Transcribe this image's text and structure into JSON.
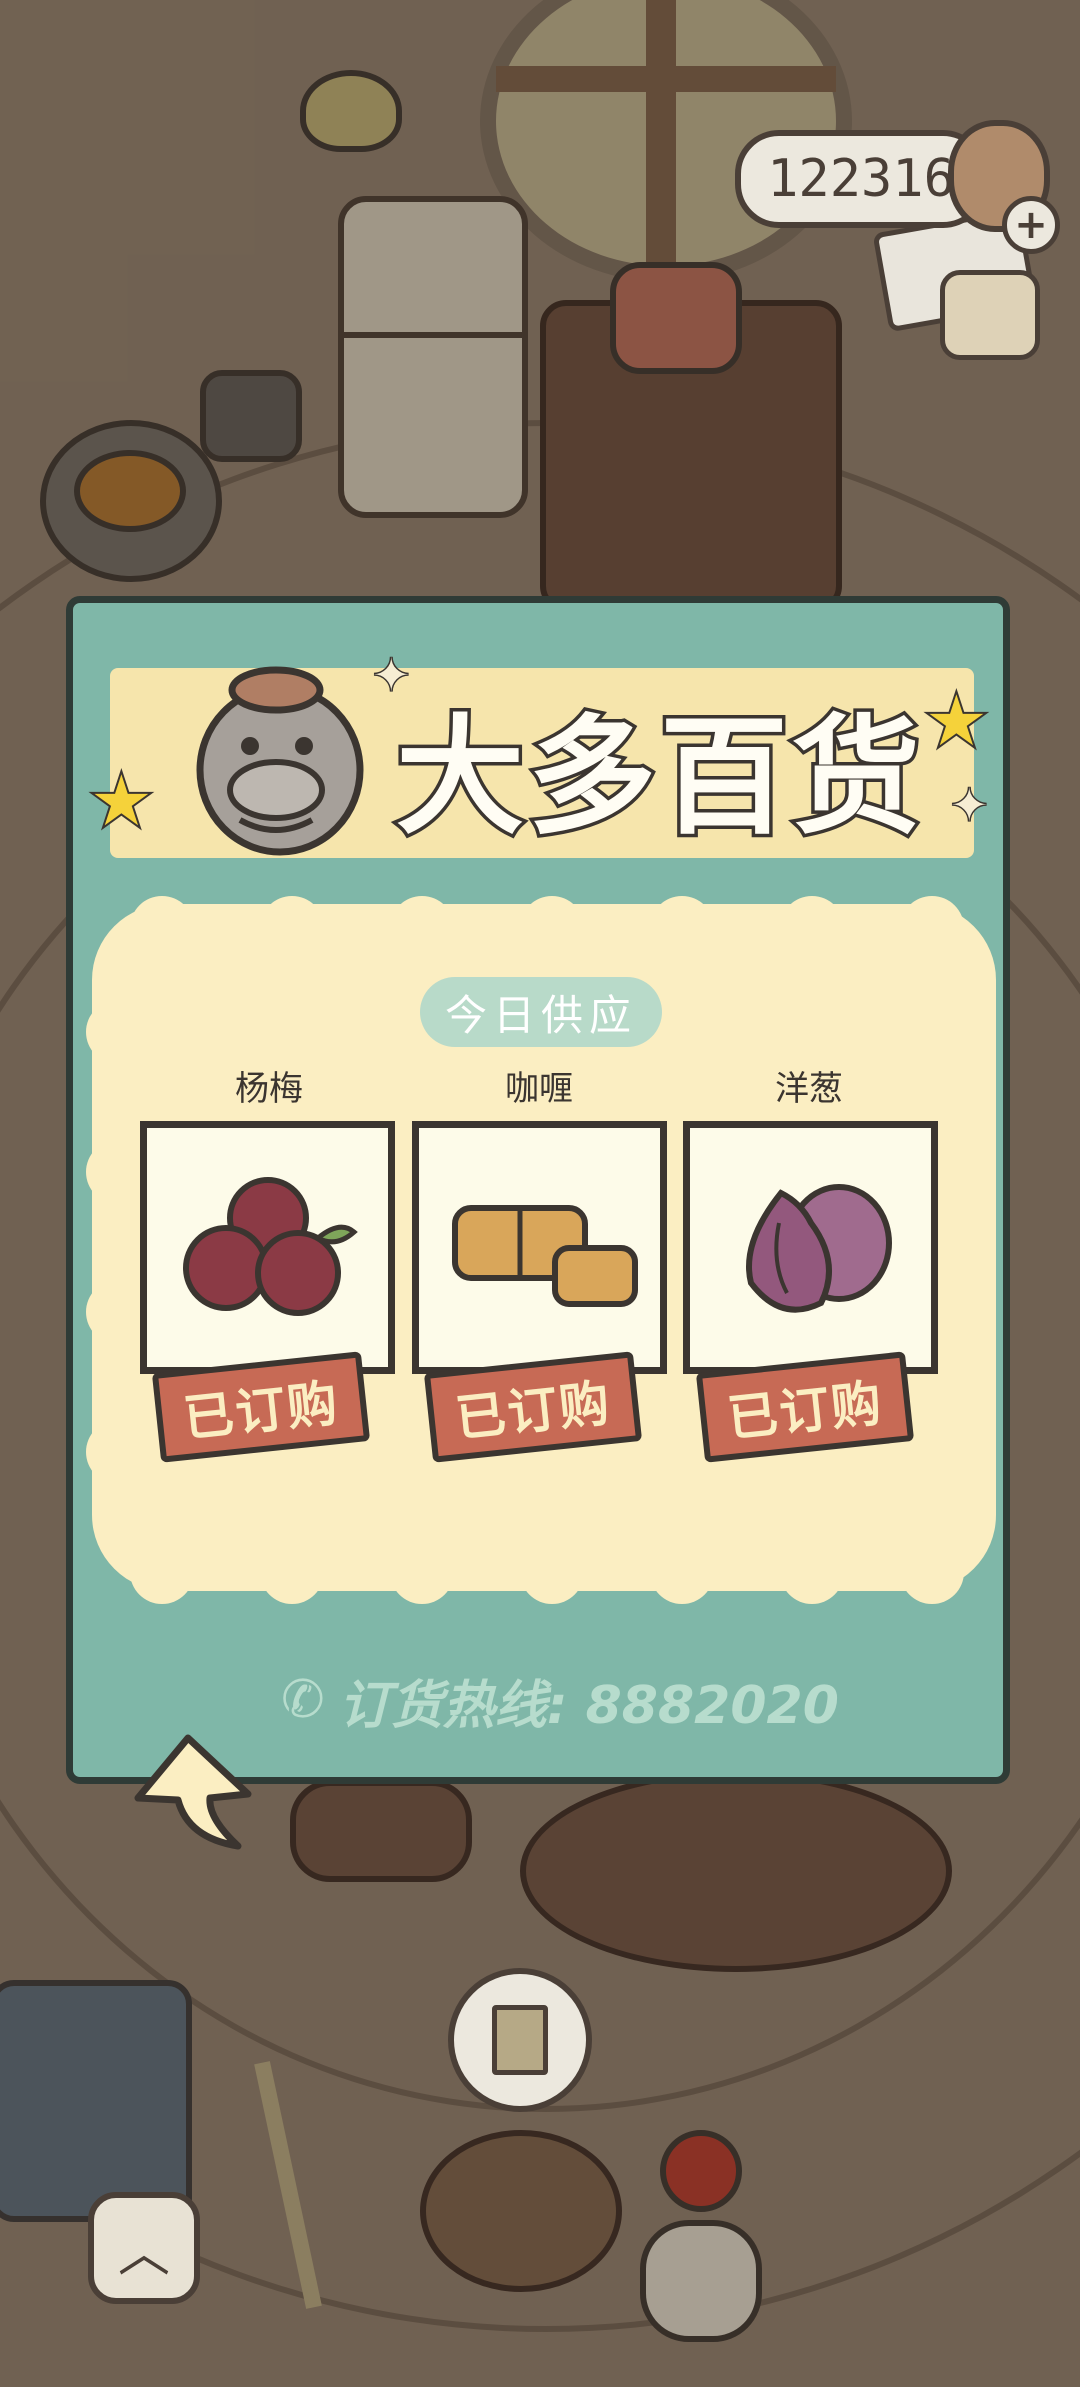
{
  "currency": {
    "amount": "122316",
    "add_label": "+"
  },
  "dialog": {
    "title": "大多百货",
    "supply_label": "今日供应",
    "items": [
      {
        "name": "杨梅",
        "status": "已订购",
        "icon": "bayberry-icon"
      },
      {
        "name": "咖喱",
        "status": "已订购",
        "icon": "curry-icon"
      },
      {
        "name": "洋葱",
        "status": "已订购",
        "icon": "onion-icon"
      }
    ],
    "hotline_label": "订货热线: 8882020"
  },
  "bottom": {
    "up_label": "︿"
  },
  "colors": {
    "dialog_bg": "#7fb7a8",
    "banner_bg": "#f6e5ac",
    "menu_bg": "#fbeec2",
    "ordered_stamp": "#c76a55",
    "outline": "#3b3530"
  }
}
